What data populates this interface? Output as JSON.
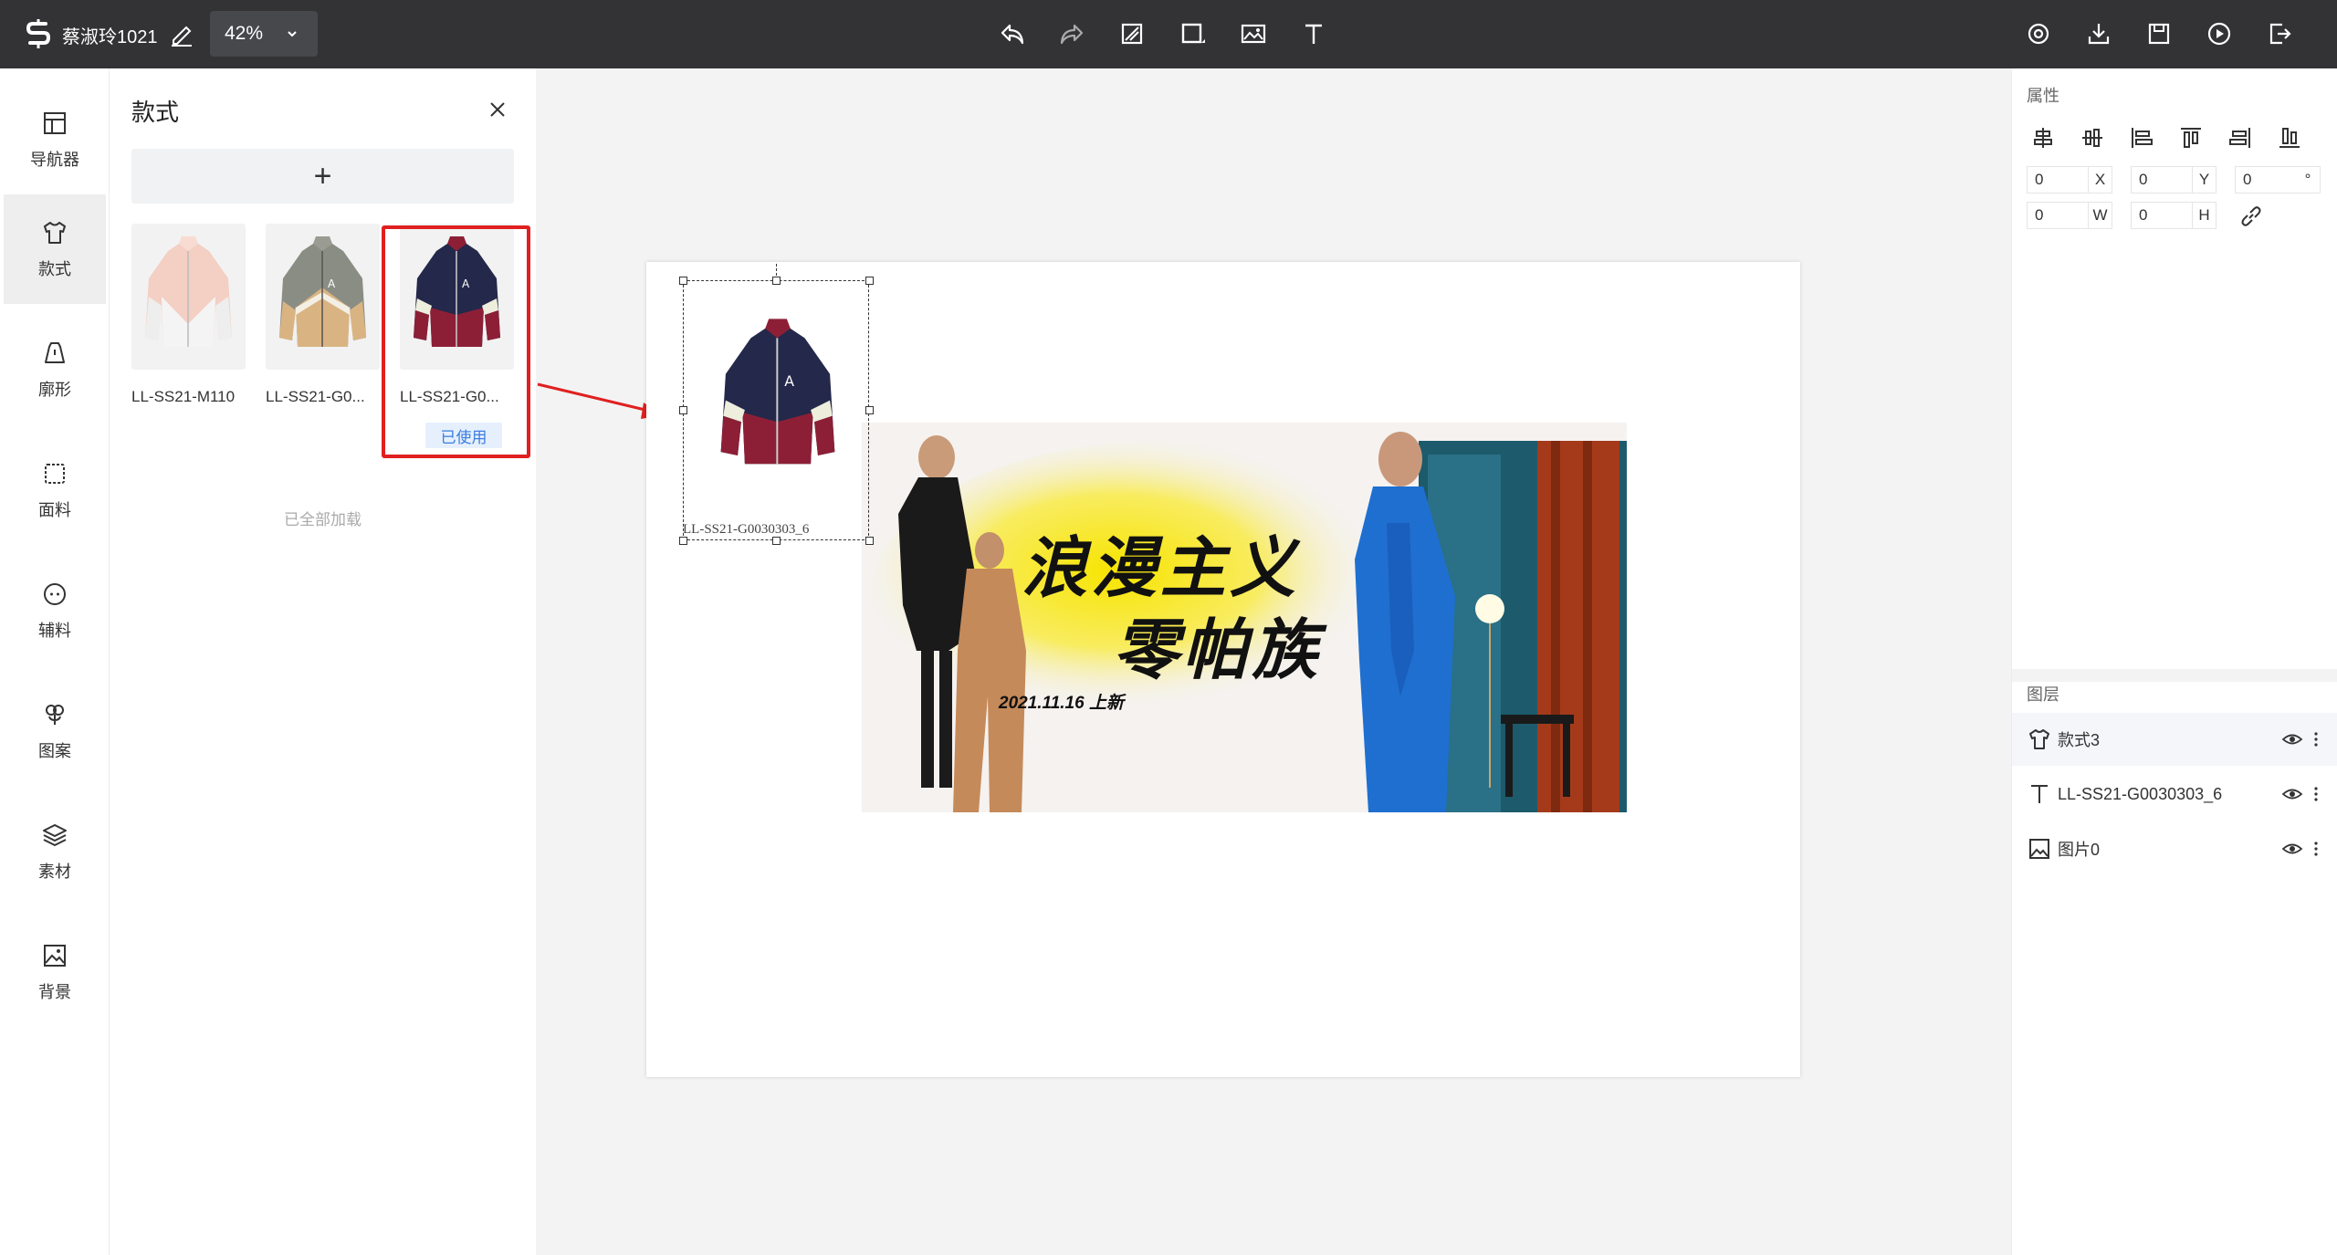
{
  "topbar": {
    "username": "蔡淑玲1021",
    "zoom_value": "42%",
    "tools": [
      "undo-icon",
      "redo-icon",
      "eraser-icon",
      "rectangle-icon",
      "image-icon",
      "text-icon"
    ],
    "actions": [
      "preview-icon",
      "download-icon",
      "save-icon",
      "play-icon",
      "exit-icon"
    ]
  },
  "leftnav": {
    "items": [
      {
        "label": "导航器",
        "icon": "navigator-icon"
      },
      {
        "label": "款式",
        "icon": "tshirt-icon"
      },
      {
        "label": "廓形",
        "icon": "silhouette-icon"
      },
      {
        "label": "面料",
        "icon": "fabric-icon"
      },
      {
        "label": "辅料",
        "icon": "button-icon"
      },
      {
        "label": "图案",
        "icon": "pattern-icon"
      },
      {
        "label": "素材",
        "icon": "layers-icon"
      },
      {
        "label": "背景",
        "icon": "background-icon"
      }
    ]
  },
  "panel": {
    "title": "款式",
    "add_label": "+",
    "items": [
      {
        "label": "LL-SS21-M110",
        "used": false
      },
      {
        "label": "LL-SS21-G0...",
        "used": false
      },
      {
        "label": "LL-SS21-G0...",
        "used": true
      }
    ],
    "used_label": "已使用",
    "loaded_all": "已全部加载"
  },
  "canvas": {
    "selected_label": "LL-SS21-G0030303_6",
    "banner": {
      "title_line1": "浪漫主义",
      "title_line2": "零帕族",
      "date_text": "2021.11.16 上新"
    }
  },
  "properties": {
    "title": "属性",
    "fields": [
      {
        "value": "0",
        "tag": "X"
      },
      {
        "value": "0",
        "tag": "Y"
      },
      {
        "value": "0",
        "tag": "°"
      },
      {
        "value": "0",
        "tag": "W"
      },
      {
        "value": "0",
        "tag": "H"
      }
    ]
  },
  "layers": {
    "title": "图层",
    "items": [
      {
        "name": "款式3",
        "icon": "tshirt-icon"
      },
      {
        "name": "LL-SS21-G0030303_6",
        "icon": "text-icon"
      },
      {
        "name": "图片0",
        "icon": "image-icon"
      }
    ]
  },
  "colors": {
    "topbar_bg": "#333335",
    "selection_red": "#e02020",
    "used_badge_blue": "#3b7de0"
  }
}
